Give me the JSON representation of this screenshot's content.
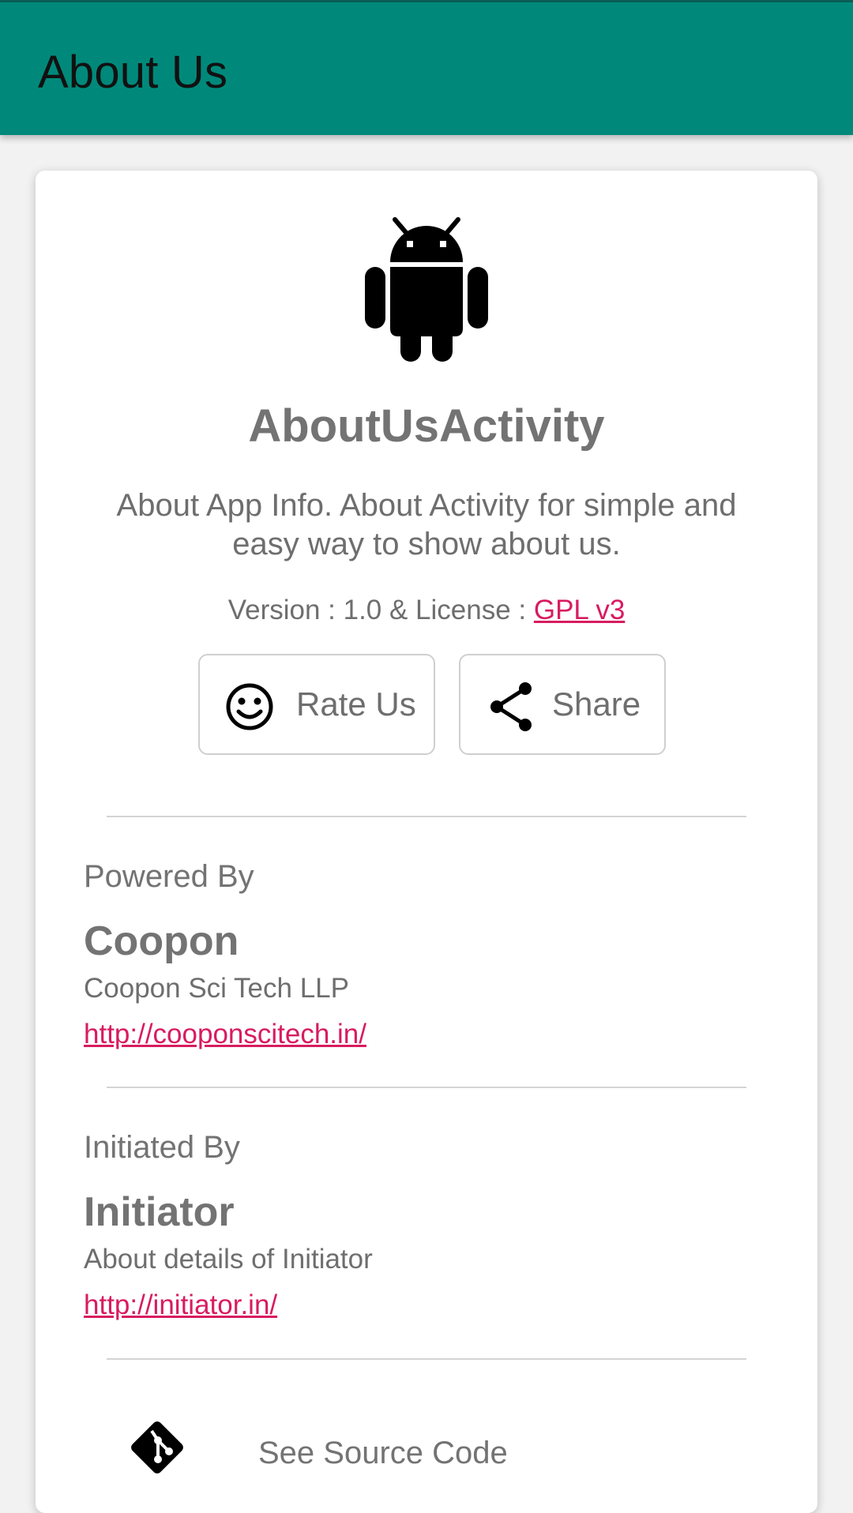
{
  "app_bar": {
    "title": "About Us",
    "color": "#00897b"
  },
  "about": {
    "icon": "android-icon",
    "app_name": "AboutUsActivity",
    "description": "About App Info. About Activity for simple and easy way to show about us.",
    "version_prefix": "Version : 1.0 & License : ",
    "license_label": "GPL v3",
    "link_color": "#d81b60"
  },
  "buttons": {
    "rate": {
      "label": "Rate Us",
      "icon": "smiley-icon"
    },
    "share": {
      "label": "Share",
      "icon": "share-icon"
    }
  },
  "powered_by": {
    "caption": "Powered By",
    "name": "Coopon",
    "subtitle": "Coopon Sci Tech LLP",
    "url": "http://cooponscitech.in/"
  },
  "initiated_by": {
    "caption": "Initiated By",
    "name": "Initiator",
    "subtitle": "About details of Initiator",
    "url": "http://initiator.in/"
  },
  "source": {
    "label": "See Source Code",
    "icon": "git-icon"
  }
}
